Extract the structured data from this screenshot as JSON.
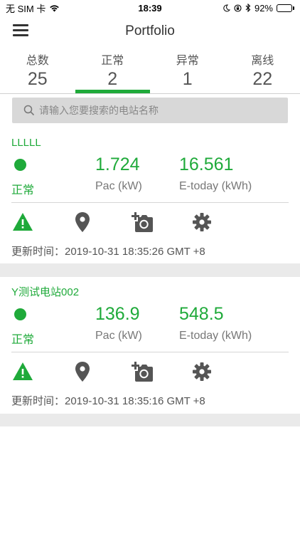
{
  "status_bar": {
    "carrier": "无 SIM 卡",
    "time": "18:39",
    "battery": "92%",
    "battery_level": 0.92
  },
  "nav": {
    "title": "Portfolio"
  },
  "tabs": [
    {
      "label": "总数",
      "count": "25"
    },
    {
      "label": "正常",
      "count": "2"
    },
    {
      "label": "异常",
      "count": "1"
    },
    {
      "label": "离线",
      "count": "22"
    }
  ],
  "search": {
    "placeholder": "请输入您要搜索的电站名称"
  },
  "stations": [
    {
      "name": "LLLLL",
      "status": "正常",
      "pac": "1.724",
      "pac_unit": "Pac (kW)",
      "etoday": "16.561",
      "etoday_unit": "E-today (kWh)",
      "update_time": "更新时间：2019-10-31 18:35:26 GMT +8"
    },
    {
      "name": "Y测试电站002",
      "status": "正常",
      "pac": "136.9",
      "pac_unit": "Pac (kW)",
      "etoday": "548.5",
      "etoday_unit": "E-today (kWh)",
      "update_time": "更新时间：2019-10-31 18:35:16 GMT +8"
    }
  ],
  "colors": {
    "accent": "#1faa3a",
    "text": "#333333",
    "icon_gray": "#555555",
    "separator": "#eaeaea"
  },
  "icons": [
    "menu-icon",
    "search-icon",
    "warning-icon",
    "location-icon",
    "add-photo-icon",
    "gear-icon"
  ]
}
